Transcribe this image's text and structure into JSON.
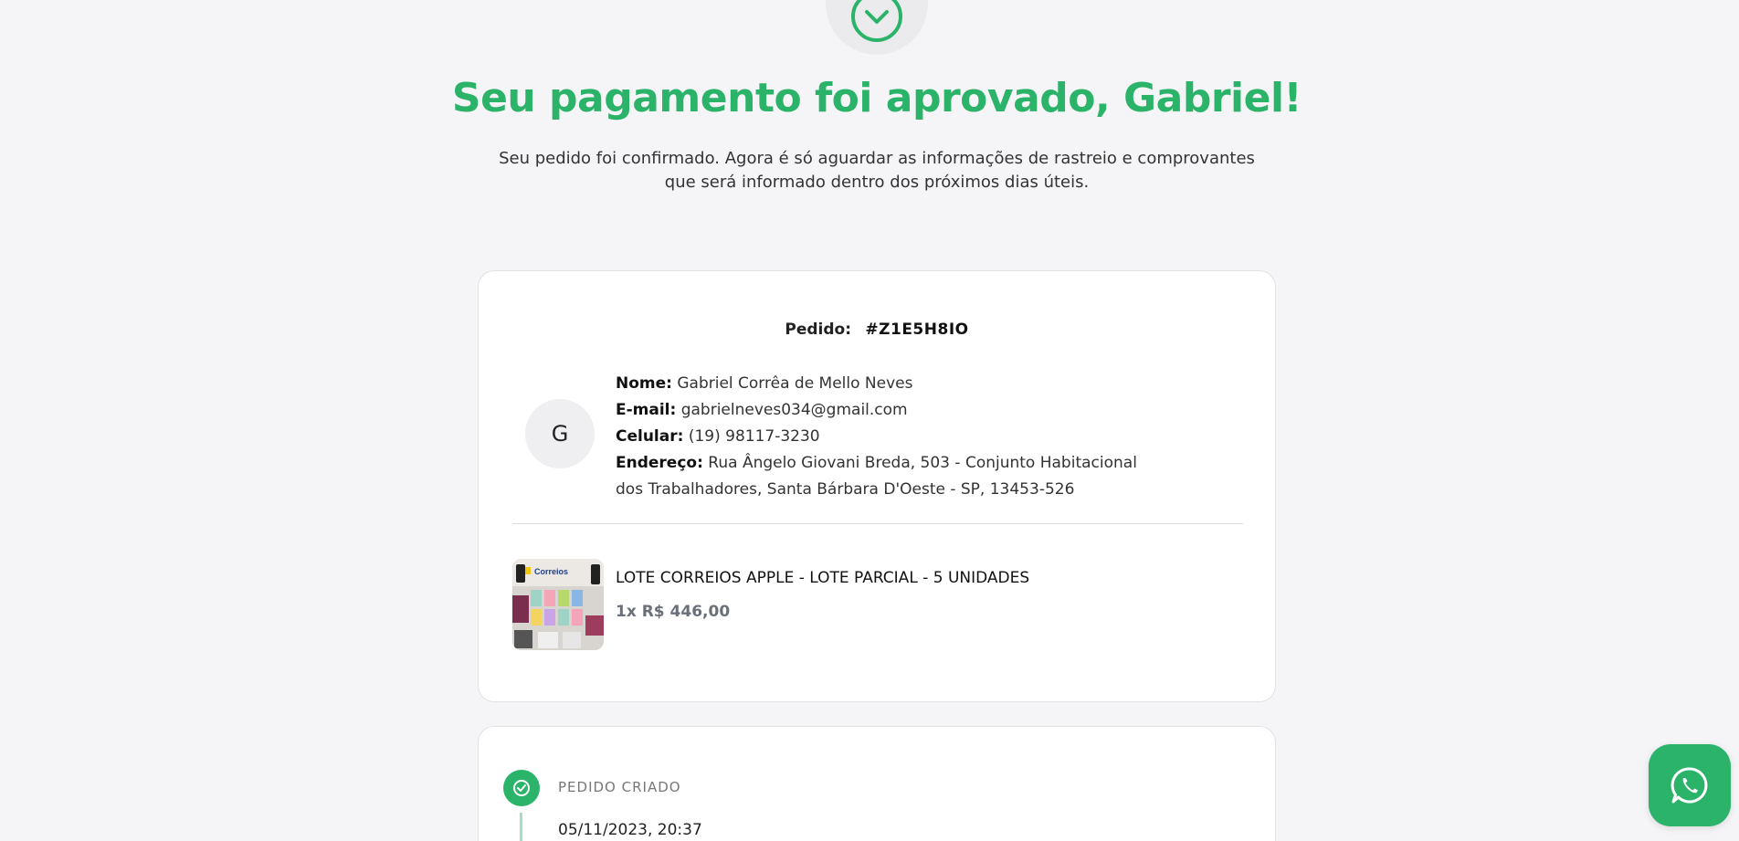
{
  "colors": {
    "accent": "#2bb36a",
    "background": "#f5f5f7",
    "card": "#ffffff"
  },
  "hero": {
    "icon": "check-circle-icon",
    "headline": "Seu pagamento foi aprovado, Gabriel!",
    "subtitle": "Seu pedido foi confirmado. Agora é só aguardar as informações de rastreio e comprovantes que será informado dentro dos próximos dias úteis."
  },
  "order": {
    "id_label": "Pedido:",
    "id_value": "#Z1E5H8IO",
    "avatar_initial": "G",
    "customer": {
      "name_label": "Nome:",
      "name": "Gabriel Corrêa de Mello Neves",
      "email_label": "E-mail:",
      "email": "gabrielneves034@gmail.com",
      "phone_label": "Celular:",
      "phone": "(19) 98117-3230",
      "address_label": "Endereço:",
      "address": "Rua Ângelo Giovani Breda, 503 - Conjunto Habitacional dos Trabalhadores, Santa Bárbara D'Oeste - SP, 13453-526"
    },
    "product": {
      "name": "LOTE CORREIOS APPLE - LOTE PARCIAL - 5 UNIDADES",
      "price": "1x R$ 446,00",
      "image_logo_text": "Correios"
    }
  },
  "timeline": [
    {
      "status": "PEDIDO CRIADO",
      "date": "05/11/2023, 20:37",
      "icon": "check-circle-icon"
    }
  ],
  "floating": {
    "icon": "whatsapp-icon"
  }
}
